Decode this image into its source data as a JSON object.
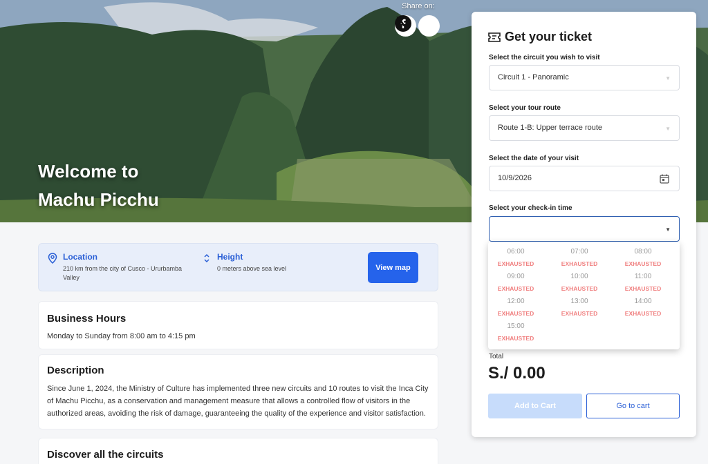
{
  "hero": {
    "title_line1": "Welcome to",
    "title_line2": "Machu Picchu",
    "share_label": "Share on:",
    "share_icons": [
      "facebook-icon",
      "x-icon"
    ]
  },
  "info": {
    "location_title": "Location",
    "location_desc": "210 km from the city of Cusco - Ururbamba Valley",
    "height_title": "Height",
    "height_desc": "0 meters above sea level",
    "map_button": "View map"
  },
  "business_hours": {
    "title": "Business Hours",
    "text": "Monday to Sunday from 8:00 am to 4:15 pm"
  },
  "description": {
    "title": "Description",
    "text": "Since June 1, 2024, the Ministry of Culture has implemented three new circuits and 10 routes to visit the Inca City of Machu Picchu, as a conservation and management measure that allows a controlled flow of visitors in the authorized areas, avoiding the risk of damage, guaranteeing the quality of the experience and visitor satisfaction."
  },
  "discover": {
    "title": "Discover all the circuits"
  },
  "ticket": {
    "title": "Get your ticket",
    "circuit_label": "Select the circuit you wish to visit",
    "circuit_value": "Circuit 1 - Panoramic",
    "route_label": "Select your tour route",
    "route_value": "Route 1-B: Upper terrace route",
    "date_label": "Select the date of your visit",
    "date_value": "10/9/2026",
    "time_label": "Select your check-in time",
    "time_value": "",
    "slots": [
      {
        "time": "06:00",
        "status": "EXHAUSTED"
      },
      {
        "time": "07:00",
        "status": "EXHAUSTED"
      },
      {
        "time": "08:00",
        "status": "EXHAUSTED"
      },
      {
        "time": "09:00",
        "status": "EXHAUSTED"
      },
      {
        "time": "10:00",
        "status": "EXHAUSTED"
      },
      {
        "time": "11:00",
        "status": "EXHAUSTED"
      },
      {
        "time": "12:00",
        "status": "EXHAUSTED"
      },
      {
        "time": "13:00",
        "status": "EXHAUSTED"
      },
      {
        "time": "14:00",
        "status": "EXHAUSTED"
      },
      {
        "time": "15:00",
        "status": "EXHAUSTED"
      }
    ],
    "total_label": "Total",
    "total_value": "S./ 0.00",
    "add_button": "Add to Cart",
    "cart_button": "Go to cart"
  },
  "colors": {
    "primary": "#2563eb",
    "exhausted": "#f08080",
    "info_bg": "#e8eefa"
  }
}
